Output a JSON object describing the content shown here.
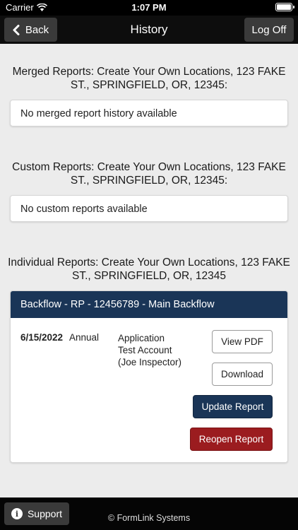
{
  "status_bar": {
    "carrier": "Carrier",
    "time": "1:07 PM"
  },
  "nav": {
    "back_label": "Back",
    "title": "History",
    "logoff_label": "Log Off"
  },
  "merged": {
    "title": "Merged Reports: Create Your Own Locations, 123 FAKE ST., SPRINGFIELD, OR, 12345:",
    "empty": "No merged report history available"
  },
  "custom": {
    "title": "Custom Reports: Create Your Own Locations, 123 FAKE ST., SPRINGFIELD, OR, 12345:",
    "empty": "No custom reports available"
  },
  "individual": {
    "title": "Individual Reports: Create Your Own Locations, 123 FAKE ST., SPRINGFIELD, OR, 12345",
    "report": {
      "header": "Backflow - RP - 12456789 - Main Backflow",
      "date": "6/15/2022",
      "type": "Annual",
      "account_line1": "Application",
      "account_line2": "Test Account",
      "account_line3": "(Joe Inspector)",
      "view_pdf": "View PDF",
      "download": "Download",
      "update": "Update Report",
      "reopen": "Reopen Report"
    }
  },
  "footer": {
    "support_label": "Support",
    "copyright": "© FormLink Systems"
  },
  "colors": {
    "header_navy": "#1a3557",
    "reopen_red": "#9b1c1f",
    "nav_black": "#0d0d0d"
  },
  "icons": {
    "back": "chevron-left-icon",
    "support": "info-icon",
    "wifi": "wifi-icon",
    "battery": "battery-icon"
  }
}
